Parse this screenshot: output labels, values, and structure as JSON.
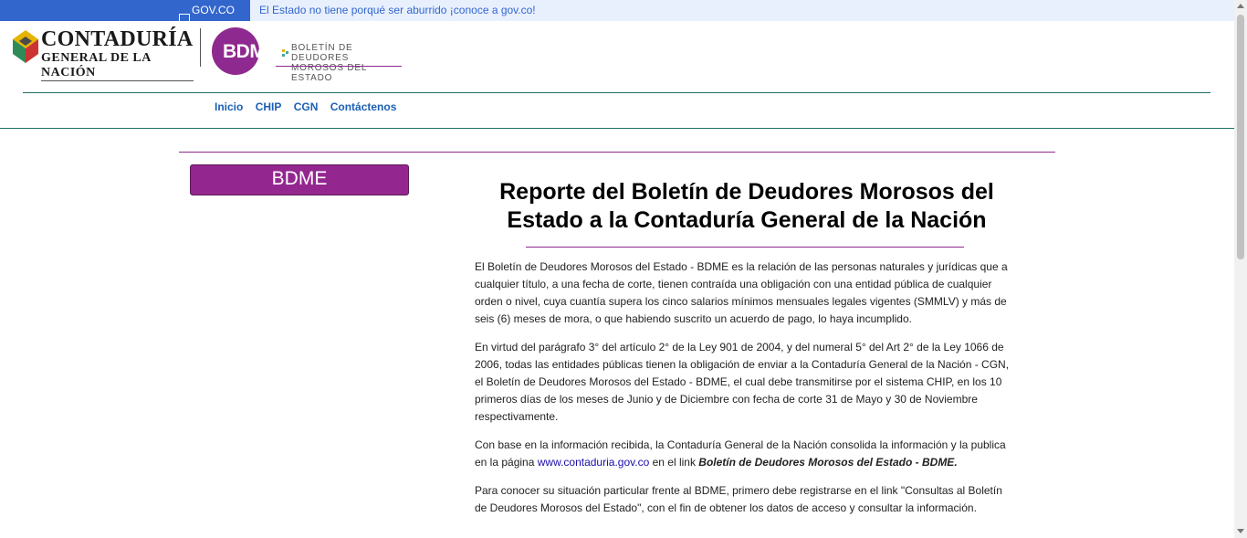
{
  "gov_bar": {
    "brand": "GOV.CO",
    "message": "El Estado no tiene porqué ser aburrido ¡conoce a gov.co!"
  },
  "header": {
    "cg_title": "CONTADURÍA",
    "cg_subtitle": "GENERAL DE LA NACIÓN",
    "bdme_logo_text": "BDME",
    "bdme_logo_line1": "BOLETÍN DE DEUDORES",
    "bdme_logo_line2": "MOROSOS DEL ESTADO"
  },
  "nav": {
    "items": [
      "Inicio",
      "CHIP",
      "CGN",
      "Contáctenos"
    ]
  },
  "sidebar": {
    "button_label": "BDME"
  },
  "main": {
    "title": "Reporte del Boletín de Deudores Morosos del Estado a la Contaduría General de la Nación",
    "p1": "El Boletín de Deudores Morosos del Estado - BDME es la relación de las personas naturales y jurídicas que a cualquier título, a una fecha de corte, tienen contraída una obligación con una entidad pública de cualquier orden o nivel, cuya cuantía supera los cinco salarios mínimos mensuales legales vigentes (SMMLV) y más de seis (6) meses de mora, o que habiendo suscrito un acuerdo de pago, lo haya incumplido.",
    "p2": "En virtud del parágrafo 3° del artículo 2° de la Ley 901 de 2004, y del numeral 5° del Art 2° de la Ley 1066 de 2006, todas las entidades públicas tienen la obligación de enviar a la Contaduría General de la Nación - CGN, el Boletín de Deudores Morosos del Estado - BDME, el cual debe transmitirse por el sistema CHIP, en los 10 primeros días de los meses de Junio y de Diciembre con fecha de corte 31 de Mayo y 30 de Noviembre respectivamente.",
    "p3_before": "Con base en la información recibida, la Contaduría General de la Nación consolida la información y la publica en la página ",
    "p3_link": "www.contaduria.gov.co",
    "p3_middle": " en el link ",
    "p3_bold": "Boletín de Deudores Morosos del Estado - BDME.",
    "p4": "Para conocer su situación particular frente al BDME, primero debe registrarse en el link \"Consultas al Boletín de Deudores Morosos del Estado\", con el fin de obtener los datos de acceso y consultar la información."
  },
  "colors": {
    "gov_blue": "#3366cc",
    "brand_purple": "#93278f",
    "teal": "#1f6f66",
    "nav_link": "#1b5fb5"
  }
}
